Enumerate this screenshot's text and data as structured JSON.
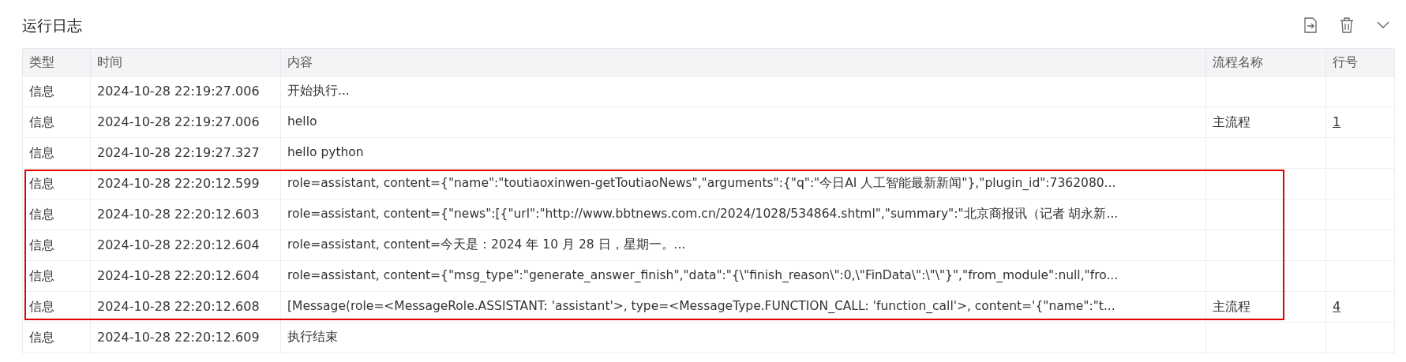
{
  "panel": {
    "title": "运行日志"
  },
  "toolbar": [
    {
      "kind": "export"
    },
    {
      "kind": "delete"
    },
    {
      "kind": "collapse"
    }
  ],
  "table": {
    "columns": [
      "类型",
      "时间",
      "内容",
      "流程名称",
      "行号"
    ],
    "rows": [
      {
        "type": "信息",
        "time": "2024-10-28 22:19:27.006",
        "content": "开始执行...",
        "flow": "",
        "line": "",
        "highlighted": false
      },
      {
        "type": "信息",
        "time": "2024-10-28 22:19:27.006",
        "content": "hello",
        "flow": "主流程",
        "line": "1",
        "highlighted": false
      },
      {
        "type": "信息",
        "time": "2024-10-28 22:19:27.327",
        "content": "hello python",
        "flow": "",
        "line": "",
        "highlighted": false
      },
      {
        "type": "信息",
        "time": "2024-10-28 22:20:12.599",
        "content": "role=assistant, content={\"name\":\"toutiaoxinwen-getToutiaoNews\",\"arguments\":{\"q\":\"今日AI 人工智能最新新闻\"},\"plugin_id\":7362080...",
        "flow": "",
        "line": "",
        "highlighted": true
      },
      {
        "type": "信息",
        "time": "2024-10-28 22:20:12.603",
        "content": "role=assistant, content={\"news\":[{\"url\":\"http://www.bbtnews.com.cn/2024/1028/534864.shtml\",\"summary\":\"北京商报讯（记者 胡永新...",
        "flow": "",
        "line": "",
        "highlighted": true
      },
      {
        "type": "信息",
        "time": "2024-10-28 22:20:12.604",
        "content": "role=assistant, content=今天是：2024 年 10 月 28 日，星期一。...",
        "flow": "",
        "line": "",
        "highlighted": true
      },
      {
        "type": "信息",
        "time": "2024-10-28 22:20:12.604",
        "content": "role=assistant, content={\"msg_type\":\"generate_answer_finish\",\"data\":\"{\\\"finish_reason\\\":0,\\\"FinData\\\":\\\"\\\"}\",\"from_module\":null,\"fro...",
        "flow": "",
        "line": "",
        "highlighted": true
      },
      {
        "type": "信息",
        "time": "2024-10-28 22:20:12.608",
        "content": "[Message(role=<MessageRole.ASSISTANT: 'assistant'>, type=<MessageType.FUNCTION_CALL: 'function_call'>, content='{\"name\":\"t...",
        "flow": "主流程",
        "line": "4",
        "highlighted": true
      },
      {
        "type": "信息",
        "time": "2024-10-28 22:20:12.609",
        "content": "执行结束",
        "flow": "",
        "line": "",
        "highlighted": false
      }
    ]
  }
}
